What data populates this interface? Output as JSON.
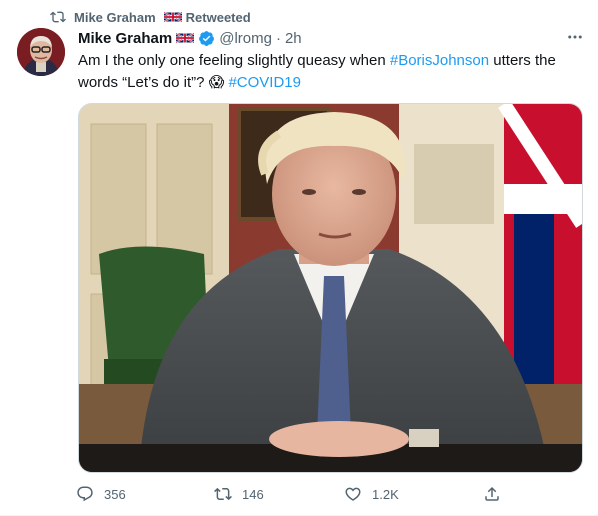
{
  "retweet": {
    "label": "Mike Graham",
    "flag_icon": "uk-flag-icon",
    "suffix": "Retweeted"
  },
  "tweet": {
    "author_name": "Mike Graham",
    "author_flag_icon": "uk-flag-icon",
    "verified": true,
    "handle": "@lromg",
    "separator": "·",
    "time": "2h",
    "more_icon": "more-icon",
    "text_parts": {
      "part1": "Am I the only one feeling slightly queasy when ",
      "hashtag1": "#BorisJohnson",
      "part2": " utters the words “Let’s do it”? ",
      "emoji": "😱",
      "part3": " ",
      "hashtag2": "#COVID19"
    }
  },
  "actions": {
    "reply_count": "356",
    "retweet_count": "146",
    "like_count": "1.2K",
    "share_icon": "share-icon"
  },
  "colors": {
    "accent": "#1d9bf0",
    "muted": "#536471",
    "text": "#0f1419"
  }
}
